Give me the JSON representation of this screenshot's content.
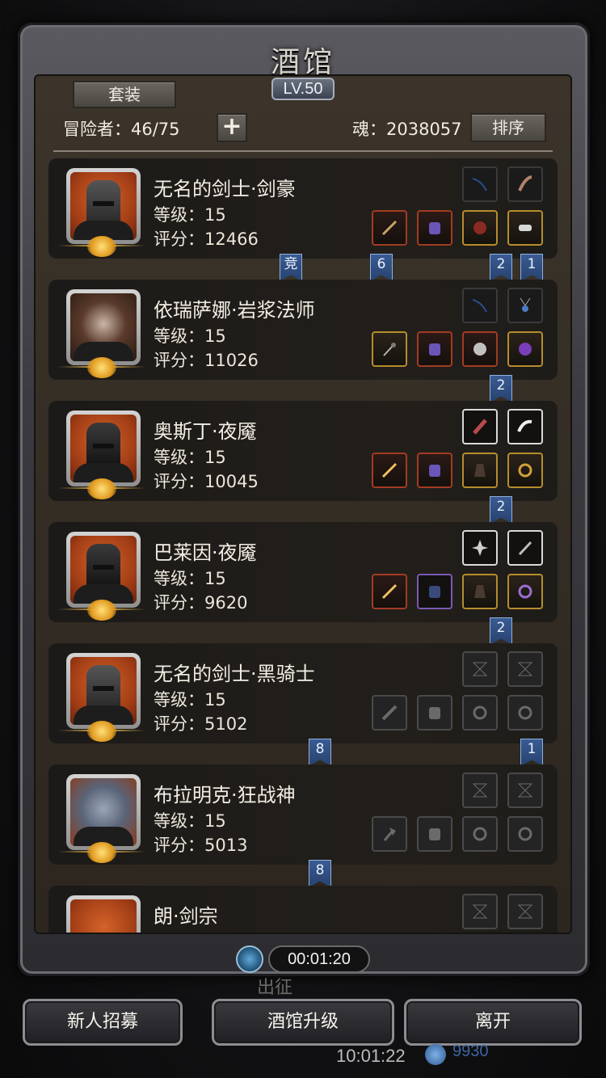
{
  "header": {
    "title": "酒馆",
    "level": "LV.50",
    "set_button": "套装",
    "adventurers": "冒险者：46/75",
    "add_button": "+",
    "soul": "魂：2038057",
    "sort_button": "排序"
  },
  "heroes": [
    {
      "name": "无名的剑士·剑豪",
      "level": "等级：15",
      "score": "评分：12466",
      "slots_top": [
        "dark-bow",
        "feather"
      ],
      "slots_bottom": [
        "sword",
        "armor",
        "helmet",
        "ring"
      ],
      "tags": [
        "竞",
        "6",
        "2",
        "1"
      ]
    },
    {
      "name": "依瑞萨娜·岩浆法师",
      "level": "等级：15",
      "score": "评分：11026",
      "slots_top": [
        "dark-bow",
        "amulet"
      ],
      "slots_bottom": [
        "staff",
        "armor",
        "helmet",
        "orb"
      ],
      "tags": [
        "2"
      ]
    },
    {
      "name": "奥斯丁·夜魇",
      "level": "等级：15",
      "score": "评分：10045",
      "slots_top": [
        "scroll",
        "feather"
      ],
      "slots_bottom": [
        "blade",
        "armor",
        "cloak",
        "ring"
      ],
      "tags": [
        "2"
      ]
    },
    {
      "name": "巴莱因·夜魇",
      "level": "等级：15",
      "score": "评分：9620",
      "slots_top": [
        "star",
        "dagger"
      ],
      "slots_bottom": [
        "blade",
        "armor",
        "cloak",
        "ring"
      ],
      "tags": [
        "2"
      ]
    },
    {
      "name": "无名的剑士·黑骑士",
      "level": "等级：15",
      "score": "评分：5102",
      "slots_top": [
        "empty",
        "empty"
      ],
      "slots_bottom": [
        "empty-sword",
        "empty-armor",
        "empty-ring",
        "empty-ring"
      ],
      "tags": [
        "8",
        "1"
      ]
    },
    {
      "name": "布拉明克·狂战神",
      "level": "等级：15",
      "score": "评分：5013",
      "slots_top": [
        "empty",
        "empty"
      ],
      "slots_bottom": [
        "empty-axe",
        "empty-armor",
        "empty-ring",
        "empty-ring"
      ],
      "tags": [
        "8"
      ]
    },
    {
      "name": "朗·剑宗",
      "level": "",
      "score": "",
      "slots_top": [
        "empty",
        "empty"
      ],
      "slots_bottom": [],
      "tags": []
    }
  ],
  "footer": {
    "timer": "00:01:20",
    "dispatch": "出征",
    "recruit_button": "新人招募",
    "upgrade_button": "酒馆升级",
    "leave_button": "离开",
    "clock": "10:01:22",
    "gems": "9930"
  },
  "colors": {
    "accent_gold": "#b58d2c",
    "tag_blue": "#27426e",
    "portrait_red": "#a33e16"
  }
}
